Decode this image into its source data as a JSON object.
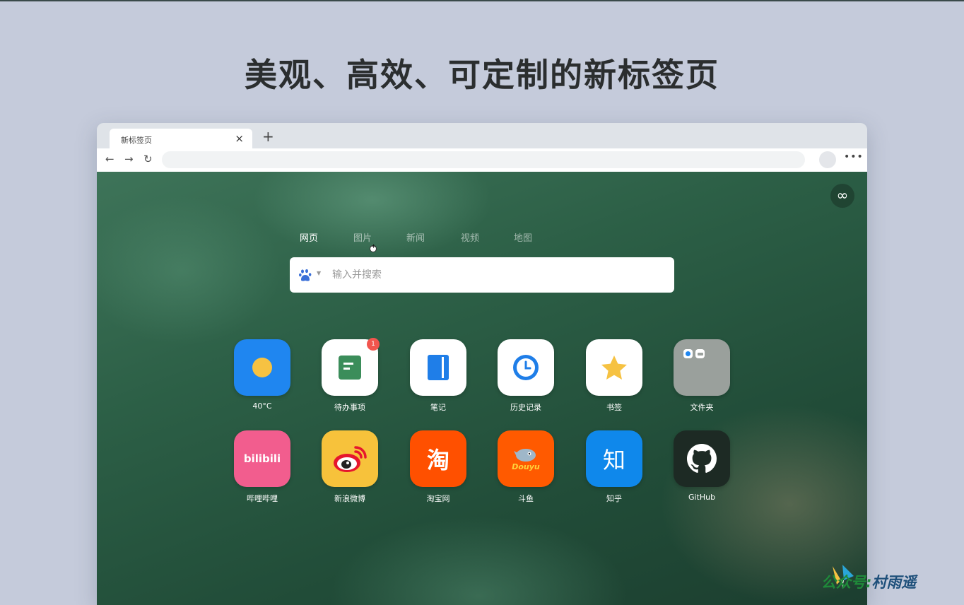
{
  "headline": "美观、高效、可定制的新标签页",
  "browser": {
    "tab_title": "新标签页",
    "close_icon": "×",
    "new_tab_icon": "+",
    "back_icon": "←",
    "forward_icon": "→",
    "reload_icon": "↻",
    "more_icon": "•••",
    "infinity_icon": "∞"
  },
  "search": {
    "tabs": [
      {
        "label": "网页",
        "active": true
      },
      {
        "label": "图片",
        "active": false
      },
      {
        "label": "新闻",
        "active": false
      },
      {
        "label": "视频",
        "active": false
      },
      {
        "label": "地图",
        "active": false
      }
    ],
    "engine_icon": "baidu-paw-icon",
    "placeholder": "输入并搜索"
  },
  "tiles": [
    {
      "label": "40°C",
      "icon": "weather-sun-icon",
      "bg": "#1f86f0"
    },
    {
      "label": "待办事项",
      "icon": "todo-icon",
      "badge": "1",
      "bg": "#ffffff"
    },
    {
      "label": "笔记",
      "icon": "notebook-icon",
      "bg": "#ffffff"
    },
    {
      "label": "历史记录",
      "icon": "clock-icon",
      "bg": "#ffffff"
    },
    {
      "label": "书签",
      "icon": "star-icon",
      "bg": "#ffffff"
    },
    {
      "label": "文件夹",
      "icon": "folder-icon",
      "bg": "#9aa09c"
    },
    {
      "label": "哔哩哔哩",
      "icon": "bilibili-logo-icon",
      "logo_text": "bilibili",
      "bg": "#f25d8e"
    },
    {
      "label": "新浪微博",
      "icon": "weibo-logo-icon",
      "bg": "#f7c23b"
    },
    {
      "label": "淘宝网",
      "icon": "taobao-logo-icon",
      "logo_text": "淘",
      "bg": "#ff5000"
    },
    {
      "label": "斗鱼",
      "icon": "douyu-logo-icon",
      "logo_text": "Douyu",
      "bg": "#ff5a00"
    },
    {
      "label": "知乎",
      "icon": "zhihu-logo-icon",
      "logo_text": "知",
      "bg": "#0f88eb"
    },
    {
      "label": "GitHub",
      "icon": "github-logo-icon",
      "bg": "#1d2a24"
    }
  ],
  "watermark": {
    "prefix": "公众号:",
    "name": "村雨遥"
  },
  "colors": {
    "page_bg": "#c5cbdb",
    "accent_blue": "#1f86f0",
    "badge_red": "#f2554e",
    "watermark_green": "#1f8a3a",
    "watermark_name": "#1d4f7a"
  }
}
